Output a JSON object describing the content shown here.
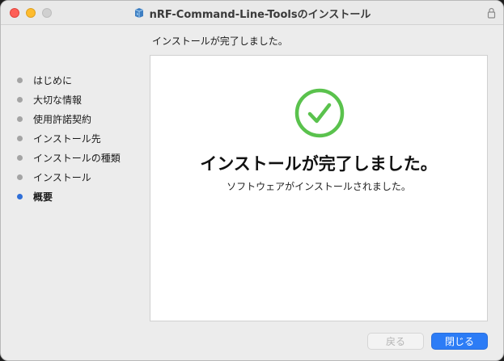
{
  "window": {
    "title": "nRF-Command-Line-Toolsのインストール"
  },
  "header": {
    "text": "インストールが完了しました。"
  },
  "sidebar": {
    "items": [
      {
        "label": "はじめに",
        "active": false
      },
      {
        "label": "大切な情報",
        "active": false
      },
      {
        "label": "使用許諾契約",
        "active": false
      },
      {
        "label": "インストール先",
        "active": false
      },
      {
        "label": "インストールの種類",
        "active": false
      },
      {
        "label": "インストール",
        "active": false
      },
      {
        "label": "概要",
        "active": true
      }
    ]
  },
  "content": {
    "title": "インストールが完了しました。",
    "subtitle": "ソフトウェアがインストールされました。",
    "icon": "checkmark-circle-icon"
  },
  "buttons": {
    "back": "戻る",
    "close": "閉じる"
  },
  "colors": {
    "accent": "#2c7cf6",
    "success": "#5ac24d",
    "active_step": "#2f6fd8",
    "inactive_step": "#a4a4a4"
  }
}
